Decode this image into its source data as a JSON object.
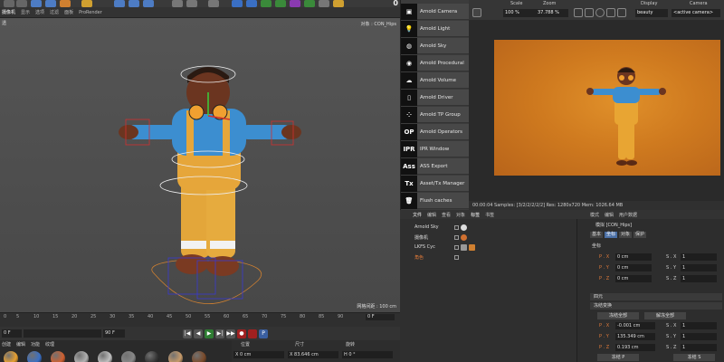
{
  "toolbar": {
    "frame_counter": "0"
  },
  "viewport_menu": [
    "摄像机",
    "显示",
    "选项",
    "过滤",
    "面板",
    "ProRender"
  ],
  "viewport": {
    "label_tl": "透",
    "object_label": "对象 : CON_Hips",
    "grid_label": "网格间距 : 100 cm"
  },
  "timeline": {
    "ticks": [
      "0",
      "5",
      "10",
      "15",
      "20",
      "25",
      "30",
      "35",
      "40",
      "45",
      "50",
      "55",
      "60",
      "65",
      "70",
      "75",
      "80",
      "85",
      "90"
    ],
    "current_frame": "0 F"
  },
  "playbar": {
    "start_field": "0 F",
    "end_field": "90 F",
    "btn_first": "|◀",
    "btn_prev": "◀",
    "btn_play": "▶",
    "btn_next": "▶|",
    "btn_last": "▶▶",
    "btn_record": "●",
    "btn_key": "P"
  },
  "materials": {
    "menu": [
      "创建",
      "编辑",
      "功能",
      "纹理"
    ],
    "balls": [
      "#e8a030",
      "#3a6fc4",
      "#d06030",
      "#b0b0b0",
      "#c0c0c0",
      "#888888",
      "#333333",
      "#c69a6a",
      "#7a4a2a"
    ]
  },
  "coords_bottom": {
    "headers": [
      "位置",
      "尺寸",
      "旋转"
    ],
    "values": [
      "X  0 cm",
      "X  83.646 cm",
      "H  0 °"
    ]
  },
  "arnold_menu": [
    {
      "icon": "camera-icon",
      "glyph": "▣",
      "label": "Arnold Camera"
    },
    {
      "icon": "light-icon",
      "glyph": "💡",
      "label": "Arnold Light"
    },
    {
      "icon": "sky-icon",
      "glyph": "◍",
      "label": "Arnold Sky"
    },
    {
      "icon": "procedural-icon",
      "glyph": "◉",
      "label": "Arnold Procedural"
    },
    {
      "icon": "volume-icon",
      "glyph": "☁",
      "label": "Arnold Volume"
    },
    {
      "icon": "driver-icon",
      "glyph": "▯",
      "label": "Arnold Driver"
    },
    {
      "icon": "tp-group-icon",
      "glyph": "⁘",
      "label": "Arnold TP Group"
    },
    {
      "icon": "operators-icon",
      "glyph": "OP",
      "label": "Arnold Operators"
    },
    {
      "icon": "ipr-icon",
      "glyph": "IPR",
      "label": "IPR Window"
    },
    {
      "icon": "ass-icon",
      "glyph": "Ass",
      "label": "ASS Export"
    },
    {
      "icon": "tx-icon",
      "glyph": "Tx",
      "label": "Asset/Tx Manager"
    },
    {
      "icon": "trash-icon",
      "glyph": "🗑",
      "label": "Flush caches"
    }
  ],
  "render_header": {
    "scale_label": "Scale",
    "scale_value": "100 %",
    "zoom_label": "Zoom",
    "zoom_value": "37.788 %",
    "display_label": "Display",
    "display_value": "beauty",
    "camera_label": "Camera",
    "camera_value": "<active camera>"
  },
  "render_status": "00:00:04  Samples: [3/2/2/2/2/2]  Res: 1280x720  Mem: 1026.64 MB",
  "object_manager": {
    "menu": [
      "文件",
      "编辑",
      "查看",
      "对象",
      "标签",
      "书签"
    ],
    "rows": [
      {
        "name": "Arnold Sky",
        "color": "#dddddd"
      },
      {
        "name": "摄像机",
        "color": "#dddddd"
      },
      {
        "name": "LKFS Cyc",
        "color": "#dddddd"
      },
      {
        "name": "角色",
        "color": "#e07a3a"
      }
    ]
  },
  "attribute_manager": {
    "menu": [
      "模式",
      "编辑",
      "用户数据"
    ],
    "object_line": "模拟 [CON_Hips]",
    "tabs": [
      "基本",
      "坐标",
      "对象",
      "保护"
    ],
    "section_coords": "坐标",
    "rows_top": [
      {
        "l1": "P . X",
        "v1": "0 cm",
        "l2": "S . X",
        "v2": "1"
      },
      {
        "l1": "P . Y",
        "v1": "0 cm",
        "l2": "S . Y",
        "v2": "1"
      },
      {
        "l1": "P . Z",
        "v1": "0 cm",
        "l2": "S . Z",
        "v2": "1"
      }
    ],
    "section_quat": "四元",
    "section_freeze": "冻结变换",
    "freeze_all": "冻结全部",
    "unfreeze_all": "解冻全部",
    "rows_bottom": [
      {
        "l1": "P . X",
        "v1": "-0.001 cm",
        "l2": "S . X",
        "v2": "1"
      },
      {
        "l1": "P . Y",
        "v1": "135.349 cm",
        "l2": "S . Y",
        "v2": "1"
      },
      {
        "l1": "P . Z",
        "v1": "0.193 cm",
        "l2": "S . Z",
        "v2": "1"
      }
    ],
    "freeze_p": "冻结 P",
    "freeze_s": "冻结 S"
  }
}
